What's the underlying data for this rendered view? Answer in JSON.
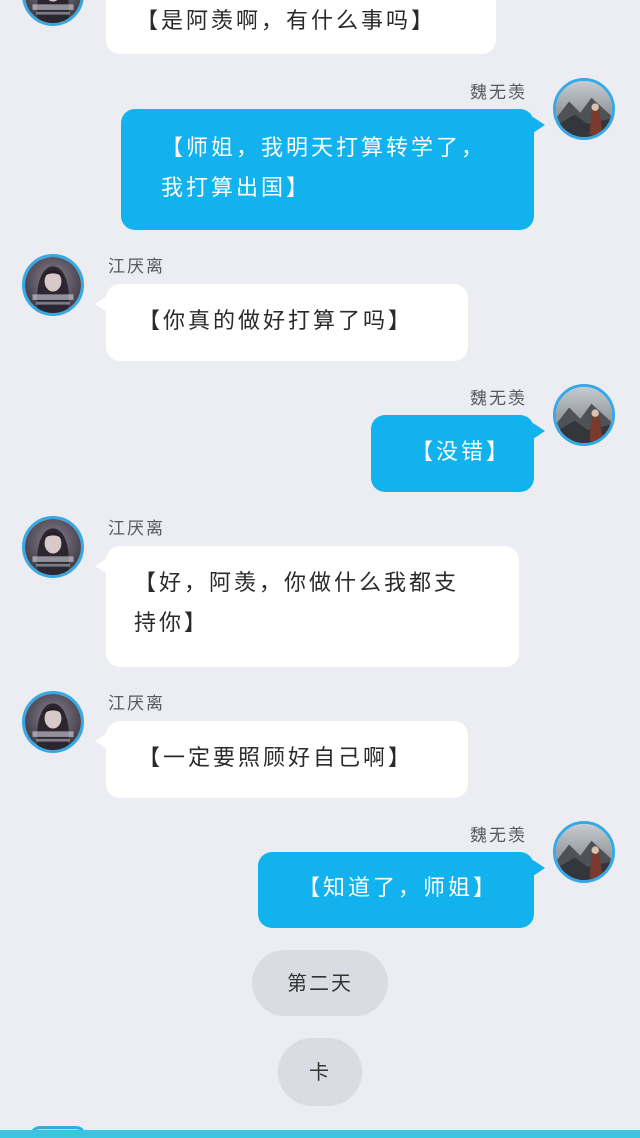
{
  "contacts": {
    "left_name": "江厌离",
    "right_name": "魏无羡"
  },
  "messages": [
    {
      "side": "left",
      "text": "【是阿羡啊，有什么事吗】"
    },
    {
      "side": "right",
      "text": "【师姐，我明天打算转学了，我打算出国】"
    },
    {
      "side": "left",
      "text": "【你真的做好打算了吗】"
    },
    {
      "side": "right",
      "text": "【没错】"
    },
    {
      "side": "left",
      "text": "【好，阿羡，你做什么我都支持你】"
    },
    {
      "side": "left",
      "text": "【一定要照顾好自己啊】"
    },
    {
      "side": "right",
      "text": "【知道了，师姐】"
    }
  ],
  "narration": [
    {
      "text": "第二天"
    },
    {
      "text": "卡"
    }
  ],
  "colors": {
    "background": "#ebedf2",
    "outgoing_bubble": "#12b2ee",
    "incoming_bubble": "#ffffff",
    "avatar_ring": "#36a8e6",
    "bottom_bar": "#3ac6e2"
  },
  "icons": {
    "left_avatar": "dark-haired-girl-avatar",
    "right_avatar": "misty-mountain-figure-avatar"
  }
}
